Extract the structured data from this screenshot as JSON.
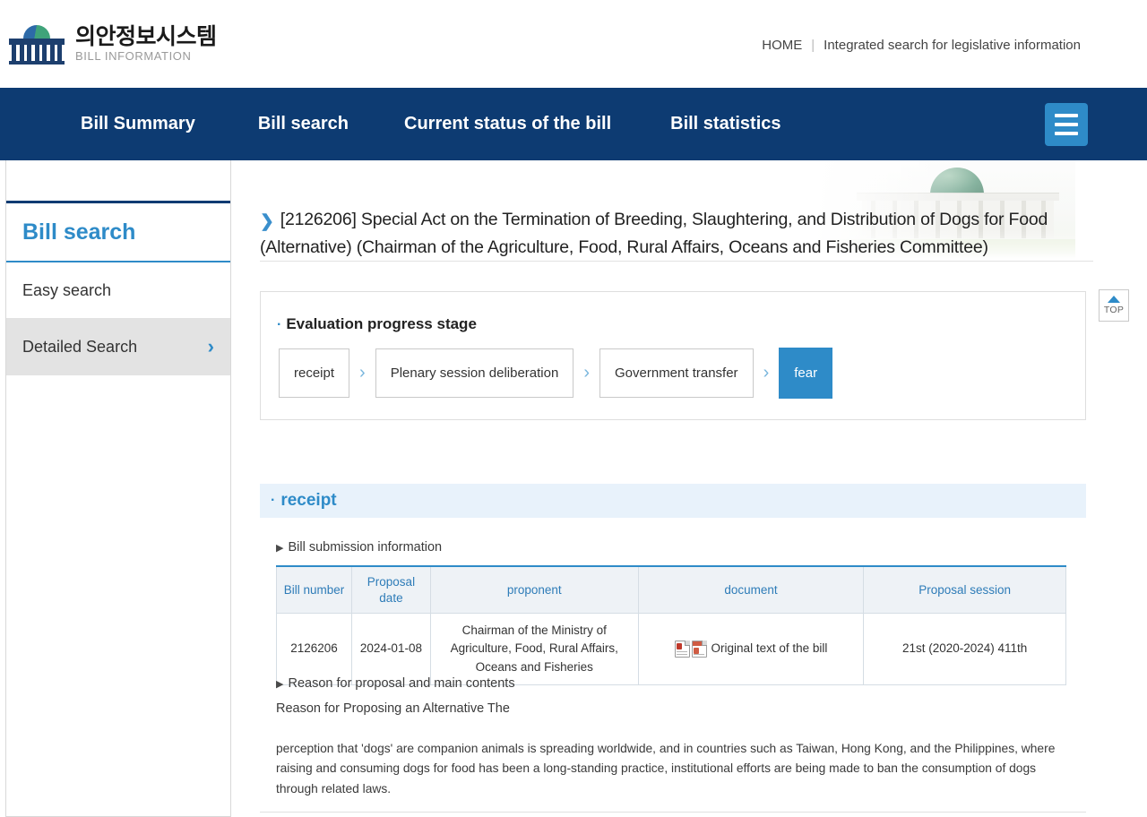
{
  "header": {
    "logo_ko": "의안정보시스템",
    "logo_en": "BILL INFORMATION",
    "links": {
      "home": "HOME",
      "separator": "|",
      "integrated": "Integrated search for legislative information"
    }
  },
  "nav": {
    "items": [
      {
        "label": "Bill Summary"
      },
      {
        "label": "Bill search"
      },
      {
        "label": "Current status of the bill"
      },
      {
        "label": "Bill statistics"
      }
    ],
    "menu_icon": "hamburger-menu-icon"
  },
  "sidebar": {
    "title": "Bill search",
    "items": [
      {
        "label": "Easy search",
        "active": false,
        "chevron": ""
      },
      {
        "label": "Detailed Search",
        "active": true,
        "chevron": "›"
      }
    ]
  },
  "main": {
    "page_title": "[2126206] Special Act on the Termination of Breeding, Slaughtering, and Distribution of Dogs for Food (Alternative) (Chairman of the Agriculture, Food, Rural Affairs, Oceans and Fisheries Committee)",
    "title_arrow": "❯",
    "progress": {
      "heading": "Evaluation progress stage",
      "bullet": "·",
      "separator": "›",
      "steps": [
        {
          "label": "receipt",
          "active": false
        },
        {
          "label": "Plenary session deliberation",
          "active": false
        },
        {
          "label": "Government transfer",
          "active": false
        },
        {
          "label": "fear",
          "active": true
        }
      ]
    },
    "section": {
      "bullet": "·",
      "title": "receipt"
    },
    "sub_headings": {
      "submission": "Bill submission information",
      "reason": "Reason for proposal and main contents",
      "triangle": "▶"
    },
    "table": {
      "headers": [
        "Bill number",
        "Proposal date",
        "proponent",
        "document",
        "Proposal session"
      ],
      "rows": [
        {
          "bill_number": "2126206",
          "proposal_date": "2024-01-08",
          "proponent": "Chairman of the Ministry of Agriculture, Food, Rural Affairs, Oceans and Fisheries",
          "document_label": "Original text of the bill",
          "document_icons": [
            "hwp-document-icon",
            "pdf-document-icon"
          ],
          "proposal_session": "21st (2020-2024) 411th"
        }
      ]
    },
    "reason_lead": "Reason for Proposing an Alternative The",
    "reason_body": "perception that 'dogs' are companion animals is spreading worldwide, and in countries such as Taiwan, Hong Kong, and the Philippines, where raising and consuming dogs for food has been a long-standing practice, institutional efforts are being made to ban the consumption of dogs through related laws."
  },
  "top_button": {
    "label": "TOP",
    "icon": "triangle-up-icon"
  },
  "colors": {
    "nav_bg": "#0d3b72",
    "accent_blue": "#2e8bc8",
    "section_bg": "#e8f2fb",
    "table_header_bg": "#eef2f6",
    "sidebar_active_bg": "#e3e3e3"
  }
}
